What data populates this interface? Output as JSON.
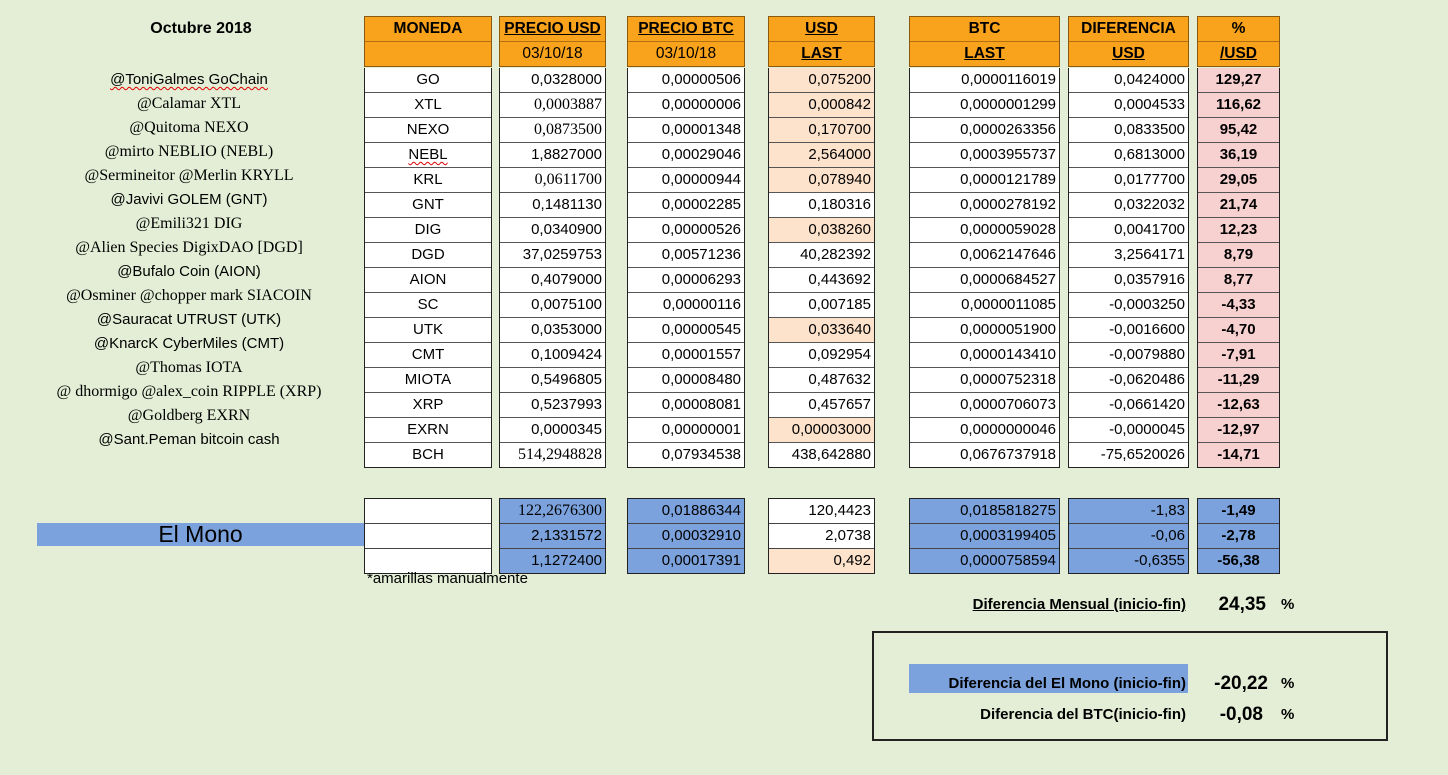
{
  "title": "Octubre 2018",
  "headers": {
    "moneda": [
      "MONEDA",
      ""
    ],
    "precio_usd": [
      "PRECIO USD",
      "03/10/18"
    ],
    "precio_btc": [
      "PRECIO BTC",
      "03/10/18"
    ],
    "usd_last": [
      "USD",
      "LAST"
    ],
    "btc_last": [
      "BTC",
      "LAST"
    ],
    "diferencia": [
      "DIFERENCIA",
      "USD"
    ],
    "pct": [
      "%",
      "/USD"
    ]
  },
  "rows": [
    {
      "owner": "@ToniGalmes GoChain",
      "coin": "GO",
      "precio_usd": "0,0328000",
      "precio_btc": "0,00000506",
      "usd_last": "0,075200",
      "btc_last": "0,0000116019",
      "dif_usd": "0,0424000",
      "pct": "129,27"
    },
    {
      "owner": "@Calamar XTL",
      "coin": "XTL",
      "precio_usd": "0,0003887",
      "precio_btc": "0,00000006",
      "usd_last": "0,000842",
      "btc_last": "0,0000001299",
      "dif_usd": "0,0004533",
      "pct": "116,62"
    },
    {
      "owner": "@Quitoma NEXO",
      "coin": "NEXO",
      "precio_usd": "0,0873500",
      "precio_btc": "0,00001348",
      "usd_last": "0,170700",
      "btc_last": "0,0000263356",
      "dif_usd": "0,0833500",
      "pct": "95,42"
    },
    {
      "owner": "@mirto NEBLIO (NEBL)",
      "coin": "NEBL",
      "precio_usd": "1,8827000",
      "precio_btc": "0,00029046",
      "usd_last": "2,564000",
      "btc_last": "0,0003955737",
      "dif_usd": "0,6813000",
      "pct": "36,19"
    },
    {
      "owner": "@Sermineitor  @Merlin KRYLL",
      "coin": "KRL",
      "precio_usd": "0,0611700",
      "precio_btc": "0,00000944",
      "usd_last": "0,078940",
      "btc_last": "0,0000121789",
      "dif_usd": "0,0177700",
      "pct": "29,05"
    },
    {
      "owner": "@Javivi GOLEM (GNT)",
      "coin": "GNT",
      "precio_usd": "0,1481130",
      "precio_btc": "0,00002285",
      "usd_last": "0,180316",
      "btc_last": "0,0000278192",
      "dif_usd": "0,0322032",
      "pct": "21,74"
    },
    {
      "owner": "@Emili321 DIG",
      "coin": "DIG",
      "precio_usd": "0,0340900",
      "precio_btc": "0,00000526",
      "usd_last": "0,038260",
      "btc_last": "0,0000059028",
      "dif_usd": "0,0041700",
      "pct": "12,23"
    },
    {
      "owner": "@Alien Species DigixDAO [DGD]",
      "coin": "DGD",
      "precio_usd": "37,0259753",
      "precio_btc": "0,00571236",
      "usd_last": "40,282392",
      "btc_last": "0,0062147646",
      "dif_usd": "3,2564171",
      "pct": "8,79"
    },
    {
      "owner": "@Bufalo Coin (AION)",
      "coin": "AION",
      "precio_usd": "0,4079000",
      "precio_btc": "0,00006293",
      "usd_last": "0,443692",
      "btc_last": "0,0000684527",
      "dif_usd": "0,0357916",
      "pct": "8,77"
    },
    {
      "owner": "@Osminer @chopper mark  SIACOIN",
      "coin": "SC",
      "precio_usd": "0,0075100",
      "precio_btc": "0,00000116",
      "usd_last": "0,007185",
      "btc_last": "0,0000011085",
      "dif_usd": "-0,0003250",
      "pct": "-4,33"
    },
    {
      "owner": "@Sauracat UTRUST (UTK)",
      "coin": "UTK",
      "precio_usd": "0,0353000",
      "precio_btc": "0,00000545",
      "usd_last": "0,033640",
      "btc_last": "0,0000051900",
      "dif_usd": "-0,0016600",
      "pct": "-4,70"
    },
    {
      "owner": "@KnarcK CyberMiles (CMT)",
      "coin": "CMT",
      "precio_usd": "0,1009424",
      "precio_btc": "0,00001557",
      "usd_last": "0,092954",
      "btc_last": "0,0000143410",
      "dif_usd": "-0,0079880",
      "pct": "-7,91"
    },
    {
      "owner": "@Thomas IOTA",
      "coin": "MIOTA",
      "precio_usd": "0,5496805",
      "precio_btc": "0,00008480",
      "usd_last": "0,487632",
      "btc_last": "0,0000752318",
      "dif_usd": "-0,0620486",
      "pct": "-11,29"
    },
    {
      "owner": "@ dhormigo @alex_coin RIPPLE (XRP)",
      "coin": "XRP",
      "precio_usd": "0,5237993",
      "precio_btc": "0,00008081",
      "usd_last": "0,457657",
      "btc_last": "0,0000706073",
      "dif_usd": "-0,0661420",
      "pct": "-12,63"
    },
    {
      "owner": "@Goldberg EXRN",
      "coin": "EXRN",
      "precio_usd": "0,0000345",
      "precio_btc": "0,00000001",
      "usd_last": "0,00003000",
      "btc_last": "0,0000000046",
      "dif_usd": "-0,0000045",
      "pct": "-12,97"
    },
    {
      "owner": "@Sant.Peman bitcoin cash",
      "coin": "BCH",
      "precio_usd": "514,2948828",
      "precio_btc": "0,07934538",
      "usd_last": "438,642880",
      "btc_last": "0,0676737918",
      "dif_usd": "-75,6520026",
      "pct": "-14,71"
    }
  ],
  "mono": {
    "label": "El Mono",
    "rows": [
      {
        "precio_usd": "122,2676300",
        "precio_btc": "0,01886344",
        "usd_last": "120,4423",
        "btc_last": "0,0185818275",
        "dif_usd": "-1,83",
        "pct": "-1,49"
      },
      {
        "precio_usd": "2,1331572",
        "precio_btc": "0,00032910",
        "usd_last": "2,0738",
        "btc_last": "0,0003199405",
        "dif_usd": "-0,06",
        "pct": "-2,78"
      },
      {
        "precio_usd": "1,1272400",
        "precio_btc": "0,00017391",
        "usd_last": "0,492",
        "btc_last": "0,0000758594",
        "dif_usd": "-0,6355",
        "pct": "-56,38"
      }
    ]
  },
  "note": "*amarillas manualmente",
  "summary": {
    "mensual_label": "Diferencia Mensual (inicio-fin)",
    "mensual_value": "24,35",
    "mono_label": "Diferencia del El Mono (inicio-fin)",
    "mono_value": "-20,22",
    "btc_label": "Diferencia del BTC(inicio-fin)",
    "btc_value": "-0,08",
    "pct_symbol": "%"
  },
  "colors": {
    "background": "#e4eed6",
    "header": "#f9a21b",
    "peach": "#fde3cc",
    "pink": "#f7d0d0",
    "blue": "#7ba2dc"
  }
}
